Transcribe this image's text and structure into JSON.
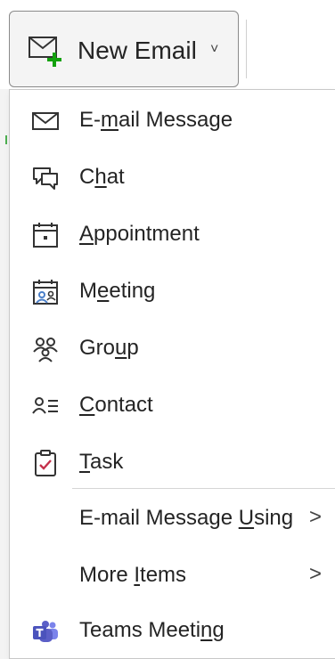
{
  "new_email": {
    "label": "New Email",
    "caret": "˅",
    "icon": "new-mail-icon"
  },
  "menu": {
    "items": [
      {
        "pre": "E-",
        "key": "m",
        "post": "ail Message",
        "icon": "envelope-icon"
      },
      {
        "pre": "C",
        "key": "h",
        "post": "at",
        "icon": "chat-icon"
      },
      {
        "pre": "",
        "key": "A",
        "post": "ppointment",
        "icon": "calendar-icon"
      },
      {
        "pre": "M",
        "key": "e",
        "post": "eting",
        "icon": "meeting-icon"
      },
      {
        "pre": "Gro",
        "key": "u",
        "post": "p",
        "icon": "group-icon"
      },
      {
        "pre": "",
        "key": "C",
        "post": "ontact",
        "icon": "contact-icon"
      },
      {
        "pre": "",
        "key": "T",
        "post": "ask",
        "icon": "task-icon"
      },
      {
        "pre": "E-mail Message ",
        "key": "U",
        "post": "sing",
        "arrow": ">"
      },
      {
        "pre": "More ",
        "key": "I",
        "post": "tems",
        "arrow": ">"
      },
      {
        "pre": "Teams Meeti",
        "key": "n",
        "post": "g",
        "icon": "teams-icon"
      }
    ]
  },
  "colors": {
    "accent_green": "#13a10e",
    "task_check_red": "#c4314b",
    "teams_purple": "#5b5fc7",
    "meeting_blue": "#4a7fc8"
  }
}
